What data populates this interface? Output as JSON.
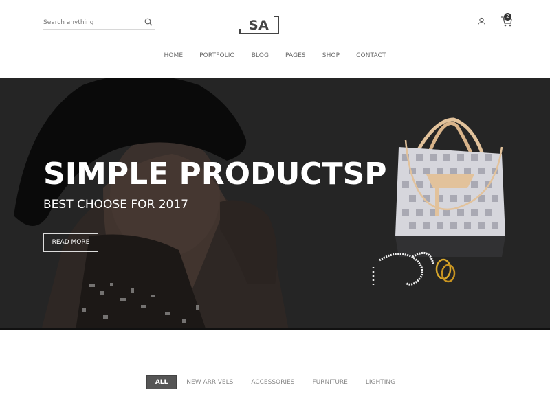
{
  "header": {
    "search": {
      "placeholder": "Search anything",
      "value": ""
    },
    "logo": "SA",
    "cart_count": "2",
    "icons": {
      "search": "search-icon",
      "user": "user-icon",
      "cart": "cart-icon"
    }
  },
  "nav": {
    "items": [
      {
        "label": "HOME"
      },
      {
        "label": "PORTFOLIO"
      },
      {
        "label": "BLOG"
      },
      {
        "label": "PAGES"
      },
      {
        "label": "SHOP"
      },
      {
        "label": "CONTACT"
      }
    ]
  },
  "hero": {
    "title": "SIMPLE PRODUCTSP",
    "subtitle": "BEST CHOOSE FOR 2017",
    "button": "READ MORE"
  },
  "filters": {
    "active": "ALL",
    "items": [
      {
        "label": "ALL"
      },
      {
        "label": "NEW ARRIVELS"
      },
      {
        "label": "ACCESSORIES"
      },
      {
        "label": "FURNITURE"
      },
      {
        "label": "LIGHTING"
      }
    ]
  }
}
